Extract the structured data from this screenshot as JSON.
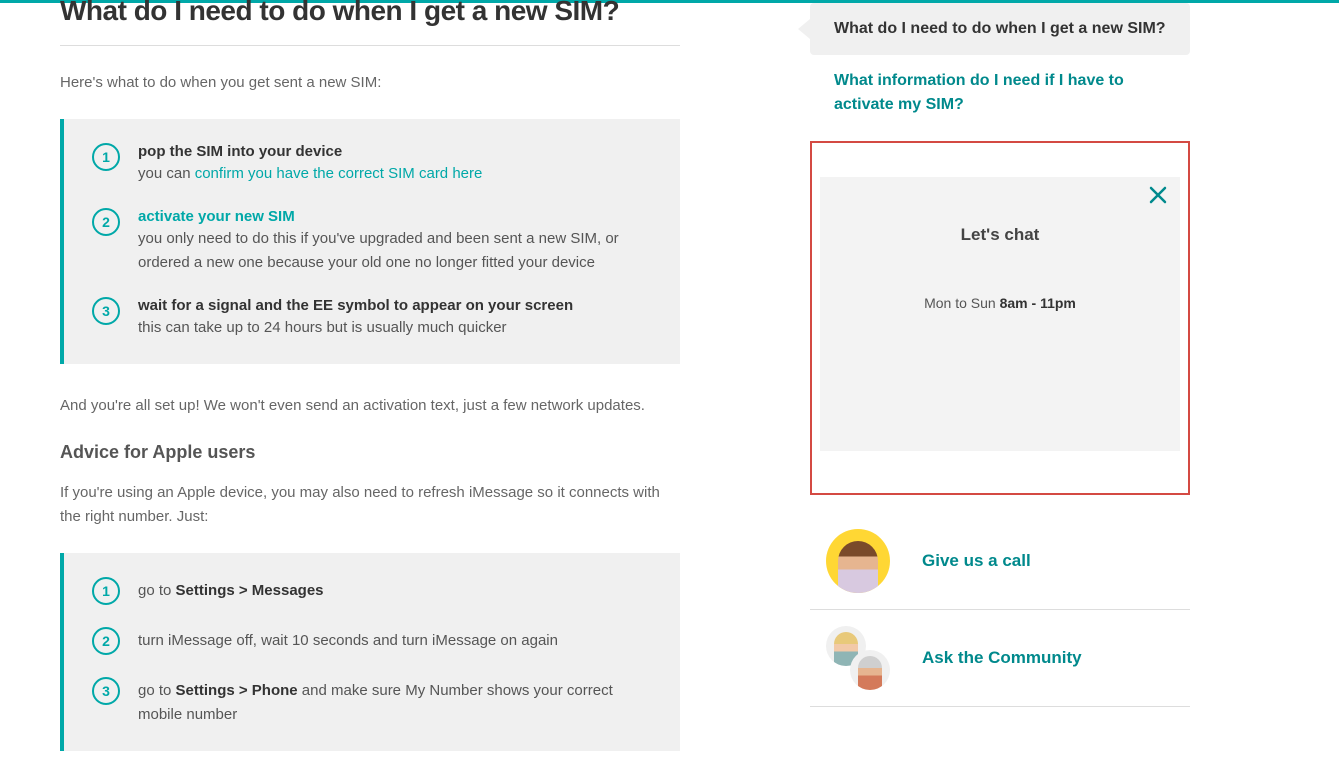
{
  "page": {
    "title": "What do I need to do when I get a new SIM?",
    "intro": "Here's what to do when you get sent a new SIM:",
    "steps1": [
      {
        "num": "1",
        "title": "pop the SIM into your device",
        "desc_prefix": "you can ",
        "desc_link": "confirm you have the correct SIM card here"
      },
      {
        "num": "2",
        "title_link": "activate your new SIM",
        "desc": "you only need to do this if you've upgraded and been sent a new SIM, or ordered a new one because your old one no longer fitted your device"
      },
      {
        "num": "3",
        "title": "wait for a signal and the EE symbol to appear on your screen",
        "desc": "this can take up to 24 hours but is usually much quicker"
      }
    ],
    "after_text": "And you're all set up! We won't even send an activation text, just a few network updates.",
    "apple_heading": "Advice for Apple users",
    "apple_intro": "If you're using an Apple device, you may also need to refresh iMessage so it connects with the right number. Just:",
    "steps2": [
      {
        "num": "1",
        "prefix": "go to ",
        "bold": "Settings > Messages"
      },
      {
        "num": "2",
        "text": "turn iMessage off, wait 10 seconds and turn iMessage on again"
      },
      {
        "num": "3",
        "prefix": "go to ",
        "bold": "Settings > Phone",
        "suffix": " and make sure My Number shows your correct mobile number"
      }
    ]
  },
  "sidebar": {
    "faq_active": "What do I need to do when I get a new SIM?",
    "faq_link": "What information do I need if I have to activate my SIM?",
    "chat": {
      "title": "Let's chat",
      "hours_prefix": "Mon to Sun ",
      "hours_bold": "8am - 11pm"
    },
    "contacts": [
      {
        "label": "Give us a call"
      },
      {
        "label": "Ask the Community"
      }
    ]
  }
}
